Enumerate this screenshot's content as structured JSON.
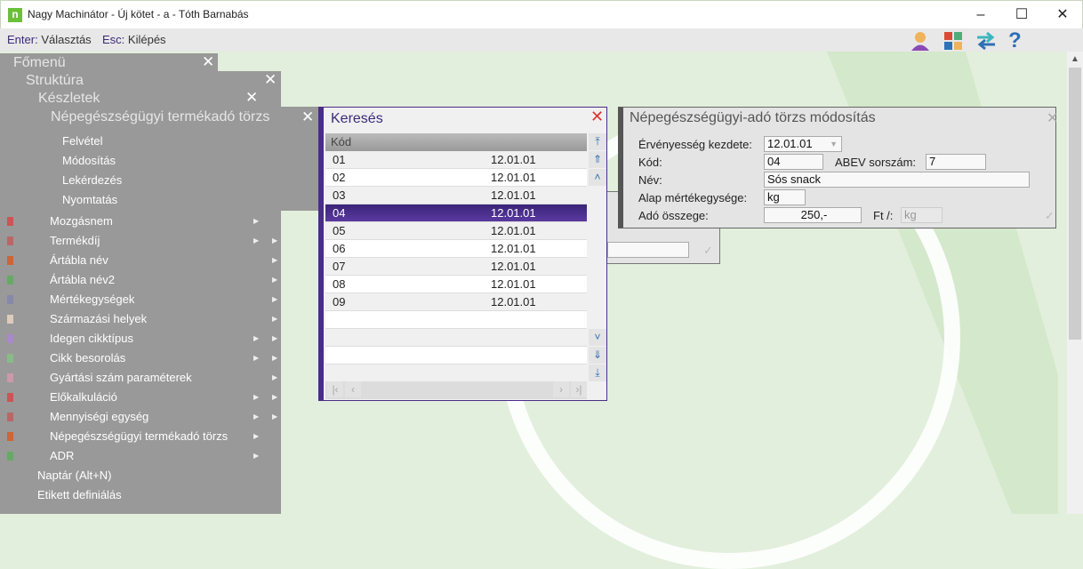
{
  "window": {
    "title": "Nagy Machinátor - Új kötet - a - Tóth Barnabás",
    "logo": "n",
    "minimize": "–",
    "maximize": "☐",
    "close": "✕"
  },
  "toolbar": {
    "enter_key": "Enter:",
    "enter_label": "Választás",
    "esc_key": "Esc:",
    "esc_label": "Kilépés"
  },
  "menus": {
    "fomenu": "Főmenü",
    "struktura": "Struktúra",
    "keszletek": "Készletek",
    "nepeg": "Népegészségügyi termékadó törzs",
    "sub_items": [
      "Felvétel",
      "Módosítás",
      "Lekérdezés",
      "Nyomtatás"
    ],
    "items": [
      "Mozgásnem",
      "Termékdíj",
      "Ártábla név",
      "Ártábla név2",
      "Mértékegységek",
      "Származási helyek",
      "Idegen cikktípus",
      "Cikk besorolás",
      "Gyártási szám paraméterek",
      "Előkalkuláció",
      "Mennyiségi egység",
      "Népegészségügyi termékadó törzs",
      "ADR"
    ],
    "top_items": [
      "Naptár (Alt+N)",
      "Etikett definiálás"
    ],
    "close": "✕"
  },
  "search": {
    "title": "Keresés",
    "close": "✕",
    "column": "Kód",
    "rows": [
      [
        "01",
        "12.01.01"
      ],
      [
        "02",
        "12.01.01"
      ],
      [
        "03",
        "12.01.01"
      ],
      [
        "04",
        "12.01.01"
      ],
      [
        "05",
        "12.01.01"
      ],
      [
        "06",
        "12.01.01"
      ],
      [
        "07",
        "12.01.01"
      ],
      [
        "08",
        "12.01.01"
      ],
      [
        "09",
        "12.01.01"
      ]
    ],
    "selected_index": 3
  },
  "form": {
    "title": "Népegészségügyi-adó törzs módosítás",
    "close": "✕",
    "confirm": "✓",
    "ervenyesseg_label": "Érvényesség kezdete:",
    "ervenyesseg_value": "12.01.01",
    "kod_label": "Kód:",
    "kod_value": "04",
    "abev_label": "ABEV sorszám:",
    "abev_value": "7",
    "nev_label": "Név:",
    "nev_value": "Sós snack",
    "alap_label": "Alap mértékegysége:",
    "alap_value": "kg",
    "ado_label": "Adó összege:",
    "ado_value": "250,-",
    "ft_label": "Ft /:",
    "ft_unit": "kg"
  },
  "colors": {
    "accent": "#4a2c8a",
    "menu_gray": "#999999",
    "background": "#e2efdc"
  }
}
